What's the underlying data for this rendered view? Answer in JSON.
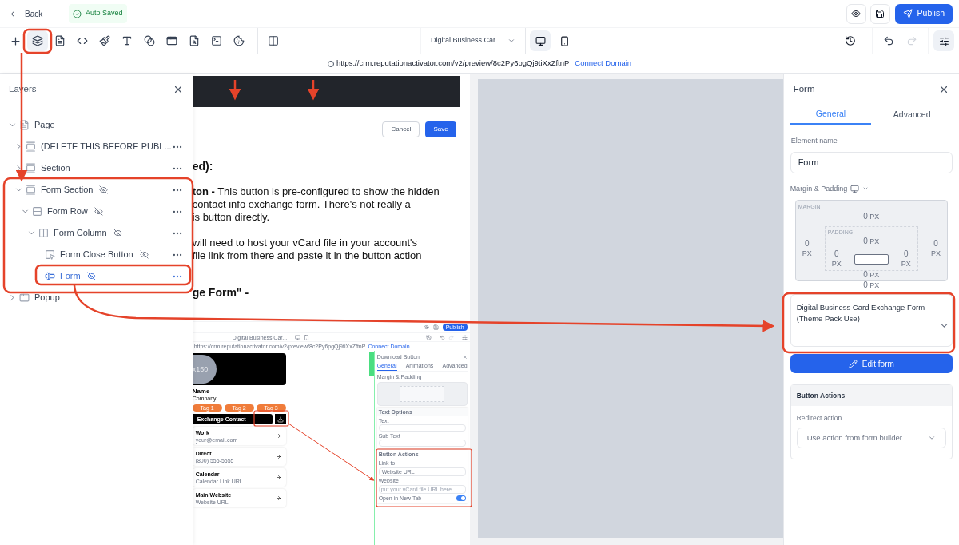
{
  "topbar": {
    "back": "Back",
    "status": "Auto Saved",
    "publish": "Publish"
  },
  "tools": [
    {
      "kind": "layers",
      "selected": true
    },
    {
      "kind": "pages",
      "selected": false
    },
    {
      "kind": "code",
      "selected": false
    },
    {
      "kind": "brush",
      "selected": false
    },
    {
      "kind": "text",
      "selected": false
    },
    {
      "kind": "blend",
      "selected": false
    },
    {
      "kind": "window",
      "selected": false
    },
    {
      "kind": "file-search",
      "selected": false
    },
    {
      "kind": "terminal",
      "selected": false
    },
    {
      "kind": "cookie",
      "selected": false
    }
  ],
  "page_selector": "Digital Business Car...",
  "devices": [
    {
      "kind": "desktop",
      "selected": true
    },
    {
      "kind": "mobile",
      "selected": false
    }
  ],
  "history": [
    {
      "kind": "undo",
      "disabled": false
    },
    {
      "kind": "redo",
      "disabled": true
    }
  ],
  "url_bar": {
    "url": "https://crm.reputationactivator.com/v2/preview/8c2Py6pgQj9tiXxZftnP",
    "link": "Connect Domain"
  },
  "layers": {
    "title": "Layers",
    "items": [
      {
        "label": "Page",
        "kind": "page",
        "expanded": true,
        "hidden": false,
        "selected": false,
        "children": [
          {
            "label": "(DELETE THIS BEFORE PUBL...",
            "kind": "section",
            "expanded": false,
            "hidden": false,
            "selected": false
          },
          {
            "label": "Section",
            "kind": "section",
            "expanded": false,
            "hidden": false,
            "selected": false
          },
          {
            "label": "Form Section",
            "kind": "section",
            "expanded": true,
            "hidden": true,
            "selected": false,
            "children": [
              {
                "label": "Form Row",
                "kind": "row",
                "expanded": true,
                "hidden": true,
                "selected": false,
                "children": [
                  {
                    "label": "Form Column",
                    "kind": "column",
                    "expanded": true,
                    "hidden": true,
                    "selected": false,
                    "children": [
                      {
                        "label": "Form Close Button",
                        "kind": "button",
                        "hidden": true,
                        "selected": false
                      },
                      {
                        "label": "Form",
                        "kind": "form",
                        "hidden": true,
                        "selected": true
                      }
                    ]
                  }
                ]
              }
            ]
          }
        ]
      },
      {
        "label": "Popup",
        "kind": "popup",
        "expanded": false,
        "hidden": false,
        "selected": false
      }
    ]
  },
  "canvas": {
    "buttons": [
      {
        "label": "Cancel",
        "kind": "secondary"
      },
      {
        "label": "Save",
        "kind": "primary"
      }
    ],
    "paragraphs": [
      {
        "kind": "heading",
        "lines": [
          "ed):"
        ]
      },
      {
        "kind": "body",
        "lines": [
          "**ton -** This button is pre-configured to show the hidden",
          "contact info exchange form. There's not really a",
          "is button directly."
        ]
      },
      {
        "kind": "body",
        "lines": [
          "will need to host your vCard file in your account's",
          "file link from there and paste it in the button action"
        ]
      },
      {
        "kind": "heading",
        "lines": [
          "ge Form\" -"
        ]
      }
    ]
  },
  "embedded": {
    "publish": "Publish",
    "page": "Digital Business Car...",
    "url": "https://crm.reputationactivator.com/v2/preview/8c2Py6pgQj9tiXxZftnP",
    "link": "Connect Domain",
    "avatar": "x150",
    "name": "Name",
    "company": "Company",
    "tags": [
      "Tag 1",
      "Tag 2",
      "Tag 3"
    ],
    "exchange": "Exchange Contact",
    "contacts": [
      {
        "title": "Work",
        "detail": "your@email.com"
      },
      {
        "title": "Direct",
        "detail": "(800) 555-5555"
      },
      {
        "title": "Calendar",
        "detail": "Calendar Link URL"
      },
      {
        "title": "Main Website",
        "detail": "Website URL"
      }
    ],
    "panel": {
      "title": "Download Button",
      "tabs": [
        {
          "label": "General",
          "selected": true
        },
        {
          "label": "Animations",
          "selected": false
        },
        {
          "label": "Advanced",
          "selected": false
        }
      ],
      "margin_label": "Margin & Padding",
      "text_options": "Text Options",
      "fields": [
        "Text",
        "Sub Text"
      ],
      "actions_title": "Button Actions",
      "link_label": "Link to",
      "link_value": "Website URL",
      "website_label": "Website",
      "website_placeholder": "put your vCard file URL here",
      "new_tab_label": "Open in New Tab",
      "new_tab_on": true
    }
  },
  "properties": {
    "title": "Form",
    "tabs": [
      {
        "label": "General",
        "selected": true
      },
      {
        "label": "Advanced",
        "selected": false
      }
    ],
    "element_name_label": "Element name",
    "element_name": "Form",
    "spacing_label": "Margin & Padding",
    "margin": {
      "label": "MARGIN",
      "top": {
        "value": "0",
        "unit": "PX"
      },
      "left": {
        "value": "0",
        "unit": "PX"
      },
      "right": {
        "value": "0",
        "unit": "PX"
      },
      "bottom": {
        "value": "0",
        "unit": "PX"
      }
    },
    "padding": {
      "label": "PADDING",
      "top": {
        "value": "0",
        "unit": "PX"
      },
      "left": {
        "value": "0",
        "unit": "PX"
      },
      "right": {
        "value": "0",
        "unit": "PX"
      },
      "bottom": {
        "value": "0",
        "unit": "PX"
      }
    },
    "form_select": "Digital Business Card Exchange Form (Theme Pack Use)",
    "edit_button": "Edit form",
    "actions": {
      "title": "Button Actions",
      "redirect_label": "Redirect action",
      "redirect_value": "Use action from form builder"
    }
  }
}
